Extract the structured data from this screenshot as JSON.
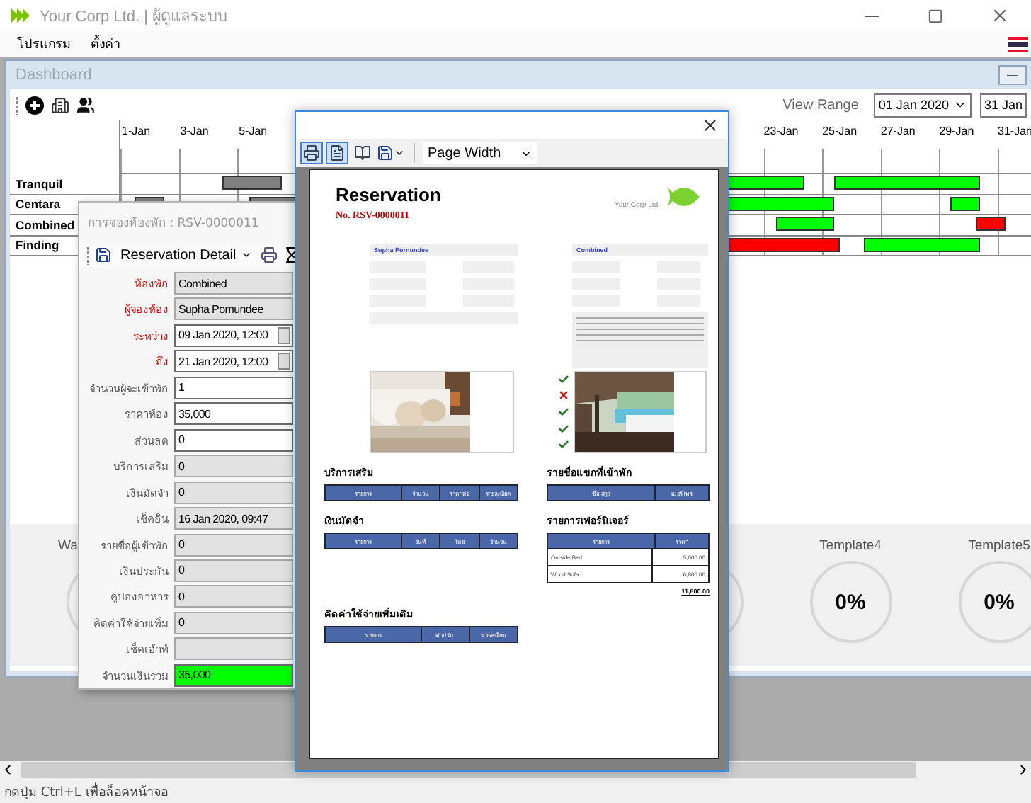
{
  "window": {
    "title": "Your Corp Ltd. | ผู้ดูแลระบบ"
  },
  "menu": [
    "โปรแกรม",
    "ตั้งค่า"
  ],
  "dashboard": {
    "title": "Dashboard",
    "view_range_label": "View Range",
    "range_start": "01 Jan 2020",
    "range_end": "31 Jan",
    "timeline": {
      "start_columns": [
        "1-Jan",
        "3-Jan",
        "5-Jan"
      ],
      "end_columns": [
        "23-Jan",
        "25-Jan",
        "27-Jan",
        "29-Jan",
        "31-Jan"
      ],
      "rows": [
        {
          "name": "Tranquil",
          "bars": [
            {
              "color": "#808080"
            },
            {
              "color": "#00ff00"
            },
            {
              "color": "#00ff00"
            }
          ]
        },
        {
          "name": "Centara",
          "bars": [
            {
              "color": "#808080"
            },
            {
              "color": "#808080"
            },
            {
              "color": "#00ff00"
            },
            {
              "color": "#00ff00"
            }
          ]
        },
        {
          "name": "Combined",
          "bars": [
            {
              "color": "#00ff00"
            },
            {
              "color": "#ff0000"
            }
          ]
        },
        {
          "name": "Finding",
          "bars": [
            {
              "color": "#ff0000"
            },
            {
              "color": "#00ff00"
            }
          ]
        }
      ]
    },
    "gauges": [
      {
        "title": "Wa",
        "kind": "cut"
      },
      {
        "kind": "covered"
      },
      {
        "kind": "covered"
      },
      {
        "kind": "covered"
      },
      {
        "kind": "ring_only"
      },
      {
        "title": "Template4",
        "value": "0%",
        "kind": "full"
      },
      {
        "title": "Template5",
        "value": "0%",
        "kind": "full"
      }
    ]
  },
  "reservation_form": {
    "title": "การจองห้องพัก : RSV-0000011",
    "layout": "Reservation Detail",
    "fields": [
      {
        "label": "ห้องพัก",
        "value": "Combined",
        "required": true,
        "disabled": true,
        "kind": "text"
      },
      {
        "label": "ผู้จองห้อง",
        "value": "Supha Pomundee",
        "required": true,
        "disabled": true,
        "kind": "text"
      },
      {
        "label": "ระหว่าง",
        "value": "09 Jan 2020, 12:00",
        "required": true,
        "disabled": false,
        "kind": "date"
      },
      {
        "label": "ถึง",
        "value": "21 Jan 2020, 12:00",
        "required": true,
        "disabled": false,
        "kind": "date"
      },
      {
        "label": "จำนวนผู้จะเข้าพัก",
        "value": "1",
        "required": false,
        "disabled": false,
        "kind": "text"
      },
      {
        "label": "ราคาห้อง",
        "value": "35,000",
        "required": false,
        "disabled": false,
        "kind": "text"
      },
      {
        "label": "ส่วนลด",
        "value": "0",
        "required": false,
        "disabled": false,
        "kind": "text"
      },
      {
        "label": "บริการเสริม",
        "value": "0",
        "required": false,
        "disabled": true,
        "kind": "text"
      },
      {
        "label": "เงินมัดจำ",
        "value": "0",
        "required": false,
        "disabled": true,
        "kind": "text"
      },
      {
        "label": "เช็คอิน",
        "value": "16 Jan 2020, 09:47",
        "required": false,
        "disabled": true,
        "kind": "text"
      },
      {
        "label": "รายชื่อผู้เข้าพัก",
        "value": "0",
        "required": false,
        "disabled": true,
        "kind": "text"
      },
      {
        "label": "เงินประกัน",
        "value": "0",
        "required": false,
        "disabled": true,
        "kind": "text"
      },
      {
        "label": "คูปองอาหาร",
        "value": "0",
        "required": false,
        "disabled": true,
        "kind": "text"
      },
      {
        "label": "คิดค่าใช้จ่ายเพิ่ม",
        "value": "0",
        "required": false,
        "disabled": true,
        "kind": "text"
      },
      {
        "label": "เช็คเอ้าท์",
        "required": false,
        "disabled": true,
        "kind": "text"
      },
      {
        "label": "จำนวนเงินรวม",
        "value": "35,000",
        "required": false,
        "kind": "total"
      }
    ]
  },
  "report_preview": {
    "tools": [
      {
        "kind": "print",
        "selected": true
      },
      {
        "kind": "page",
        "selected": true
      },
      {
        "kind": "book",
        "selected": false
      }
    ],
    "zoom": "Page Width",
    "report": {
      "title": "Reservation",
      "number": "No. RSV-0000011",
      "company": "Your Corp Ltd.",
      "customer": "Supha Pornundee",
      "room": "Combined",
      "amenities": [
        {
          "checked": true
        },
        {
          "checked": false
        },
        {
          "checked": true
        },
        {
          "checked": true
        },
        {
          "checked": true
        }
      ],
      "tables": [
        {
          "title": "บริการเสริม",
          "columns": [
            "รายการ",
            "จำนวน",
            "ราคาต่อ",
            "รายละเอียด"
          ]
        },
        {
          "title": "รายชื่อแขกที่เข้าพัก",
          "columns": [
            "ชื่อ-สกุล",
            "เบอร์โทร"
          ]
        },
        {
          "title": "เงินมัดจำ",
          "columns": [
            "รายการ",
            "วันที่",
            "โดย",
            "จำนวน"
          ]
        },
        {
          "title": "รายการเฟอร์นิเจอร์",
          "columns": [
            "รายการ",
            "ราคา"
          ],
          "rows": [
            [
              "Outside Bed",
              "5,000.00"
            ],
            [
              "Wood Sofa",
              "6,800.00"
            ]
          ],
          "total": "11,800.00"
        },
        {
          "title": "คิดค่าใช้จ่ายเพิ่มเติม",
          "columns": [
            "รายการ",
            "ค่าปรับ",
            "รายละเอียด"
          ]
        }
      ]
    }
  },
  "status_bar": "กดปุ่ม Ctrl+L เพื่อล็อคหน้าจอ"
}
